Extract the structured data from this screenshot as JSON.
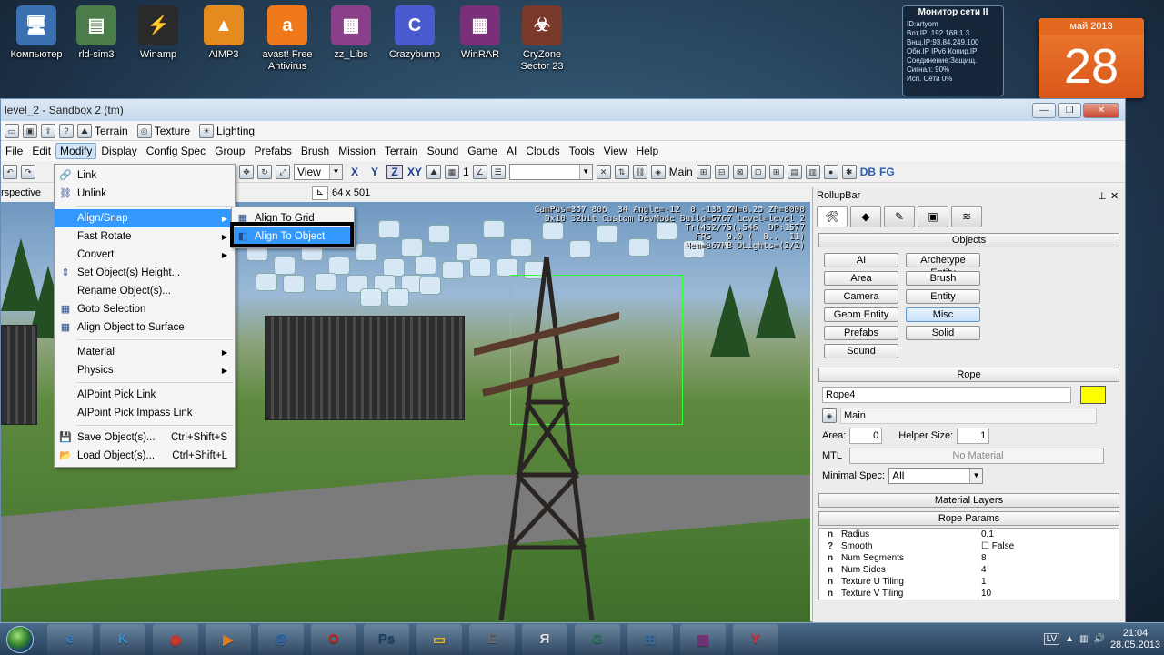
{
  "desktop": {
    "icons": [
      {
        "label": "Компьютер",
        "icon": "computer-icon",
        "glyph": "🖥",
        "color": "#3a6fb0"
      },
      {
        "label": "rld-sim3",
        "icon": "file-icon",
        "glyph": "▤",
        "color": "#4b7d4b"
      },
      {
        "label": "Winamp",
        "icon": "winamp-icon",
        "glyph": "⚡",
        "color": "#2a2a2a"
      },
      {
        "label": "AIMP3",
        "icon": "aimp-icon",
        "glyph": "▲",
        "color": "#e58a1f"
      },
      {
        "label": "avast! Free\nAntivirus",
        "icon": "avast-icon",
        "glyph": "a",
        "color": "#f07a1a"
      },
      {
        "label": "zz_Libs",
        "icon": "archive-icon",
        "glyph": "▦",
        "color": "#8a3f8a"
      },
      {
        "label": "Crazybump",
        "icon": "crazybump-icon",
        "glyph": "C",
        "color": "#4a5bd0"
      },
      {
        "label": "WinRAR",
        "icon": "winrar-icon",
        "glyph": "▦",
        "color": "#7a2f7a"
      },
      {
        "label": "CryZone\nSector 23",
        "icon": "cryzone-icon",
        "glyph": "☣",
        "color": "#7a3a2a"
      }
    ],
    "net_gadget": {
      "title": "Монитор сети II",
      "lines": [
        "ID:artyom",
        "Вnт.IP: 192.168.1.3",
        "Внщ.IP:93.84.249.100",
        "Обн.IP  IPv6  Копир.IP",
        "Соединение:Защищ.",
        "Сигнал:              90%",
        "Исп. Сети           0%"
      ]
    },
    "calendar": {
      "month": "май 2013",
      "day": "28"
    }
  },
  "window": {
    "title": "level_2 - Sandbox 2 (tm)",
    "controls": [
      "—",
      "❐",
      "✕"
    ],
    "toolbar1": {
      "terrain": "Terrain",
      "texture": "Texture",
      "lighting": "Lighting"
    },
    "menubar": [
      "File",
      "Edit",
      "Modify",
      "Display",
      "Config Spec",
      "Group",
      "Prefabs",
      "Brush",
      "Mission",
      "Terrain",
      "Sound",
      "Game",
      "AI",
      "Clouds",
      "Tools",
      "View",
      "Help"
    ],
    "active_menu": "Modify",
    "toolbar2": {
      "view_combo": "View",
      "axes": [
        "X",
        "Y",
        "Z",
        "XY"
      ],
      "layer": "Main",
      "grid_value": "1",
      "db": "DB",
      "fg": "FG"
    },
    "viewport_label": "rspective",
    "resolution": "64 x 501",
    "hud": "CamPos=357 806  34 Angle=-12  0 -138 ZN=0.25 ZF=8000\nDx10 32bit Custom DevMode Build=5767 Level=level_2\nTr(452/75(.546  DP:1577\nFPS   9.0 (  8..  11)\nMem=867MB DLights=(2/2)"
  },
  "modify_menu": {
    "items": [
      {
        "label": "Link",
        "icon": "link-icon",
        "glyph": "🔗"
      },
      {
        "label": "Unlink",
        "icon": "unlink-icon",
        "glyph": "⛓"
      },
      {
        "sep": true
      },
      {
        "label": "Align/Snap",
        "sub": true,
        "hl": true
      },
      {
        "label": "Fast Rotate",
        "sub": true
      },
      {
        "label": "Convert",
        "sub": true
      },
      {
        "label": "Set Object(s) Height...",
        "icon": "height-icon",
        "glyph": "⇕"
      },
      {
        "label": "Rename Object(s)...",
        "icon": "",
        "glyph": ""
      },
      {
        "label": "Goto Selection",
        "icon": "goto-icon",
        "glyph": "▦"
      },
      {
        "label": "Align Object to Surface",
        "icon": "align-surface-icon",
        "glyph": "▦"
      },
      {
        "sep": true
      },
      {
        "label": "Material",
        "sub": true
      },
      {
        "label": "Physics",
        "sub": true
      },
      {
        "sep": true
      },
      {
        "label": "AIPoint Pick Link"
      },
      {
        "label": "AIPoint Pick Impass Link"
      },
      {
        "sep": true
      },
      {
        "label": "Save Object(s)...",
        "shortcut": "Ctrl+Shift+S",
        "icon": "save-icon",
        "glyph": "💾"
      },
      {
        "label": "Load Object(s)...",
        "shortcut": "Ctrl+Shift+L",
        "icon": "load-icon",
        "glyph": "📂"
      }
    ]
  },
  "align_submenu": {
    "items": [
      {
        "label": "Align To Grid",
        "icon": "grid-icon",
        "glyph": "▦"
      },
      {
        "label": "Align To Object",
        "icon": "align-object-icon",
        "glyph": "◧",
        "hl": true
      }
    ]
  },
  "rollup": {
    "title": "RollupBar",
    "objects_header": "Objects",
    "object_buttons": [
      "AI",
      "Archetype Entity",
      "Area",
      "Brush",
      "Camera",
      "Entity",
      "Geom Entity",
      "Misc",
      "Prefabs",
      "Solid",
      "Sound"
    ],
    "selected_button": "Misc",
    "rope_header": "Rope",
    "rope_name": "Rope4",
    "rope_color": "#ffff00",
    "layer": "Main",
    "area_label": "Area:",
    "area_value": "0",
    "helper_label": "Helper Size:",
    "helper_value": "1",
    "mtl_label": "MTL",
    "mtl_value": "No Material",
    "minspec_label": "Minimal Spec:",
    "minspec_value": "All",
    "material_layers": "Material Layers",
    "rope_params_header": "Rope Params",
    "params": [
      {
        "icon": "n",
        "name": "Radius",
        "value": "0.1"
      },
      {
        "icon": "?",
        "name": "Smooth",
        "value": "☐ False"
      },
      {
        "icon": "n",
        "name": "Num Segments",
        "value": "8"
      },
      {
        "icon": "n",
        "name": "Num Sides",
        "value": "4"
      },
      {
        "icon": "n",
        "name": "Texture U Tiling",
        "value": "1"
      },
      {
        "icon": "n",
        "name": "Texture V Tiling",
        "value": "10"
      }
    ]
  },
  "taskbar": {
    "apps": [
      {
        "icon": "ie-icon",
        "glyph": "e",
        "color": "#2f7fd0"
      },
      {
        "icon": "kmplayer-icon",
        "glyph": "K",
        "color": "#3a8fd0"
      },
      {
        "icon": "chrome-icon",
        "glyph": "◉",
        "color": "#d33a2a"
      },
      {
        "icon": "media-player-icon",
        "glyph": "▶",
        "color": "#e07a1a"
      },
      {
        "icon": "mail-icon",
        "glyph": "@",
        "color": "#2a6fc0"
      },
      {
        "icon": "opera-icon",
        "glyph": "O",
        "color": "#c8201a"
      },
      {
        "icon": "photoshop-icon",
        "glyph": "Ps",
        "color": "#1a3f6a"
      },
      {
        "icon": "explorer-icon",
        "glyph": "▭",
        "color": "#e0b23a"
      },
      {
        "icon": "sandbox-icon",
        "glyph": "E",
        "color": "#6a6a6a"
      },
      {
        "icon": "yandex-icon",
        "glyph": "Я",
        "color": "#e0e0e0"
      },
      {
        "icon": "g-icon",
        "glyph": "G",
        "color": "#2a7a5a"
      },
      {
        "icon": "network-icon",
        "glyph": "⊞",
        "color": "#3a6aa0"
      },
      {
        "icon": "winrar-task-icon",
        "glyph": "▦",
        "color": "#7a2f7a"
      },
      {
        "icon": "yandex-browser-icon",
        "glyph": "Y",
        "color": "#e02a2a"
      }
    ],
    "lang": "LV",
    "time": "21:04",
    "date": "28.05.2013"
  }
}
